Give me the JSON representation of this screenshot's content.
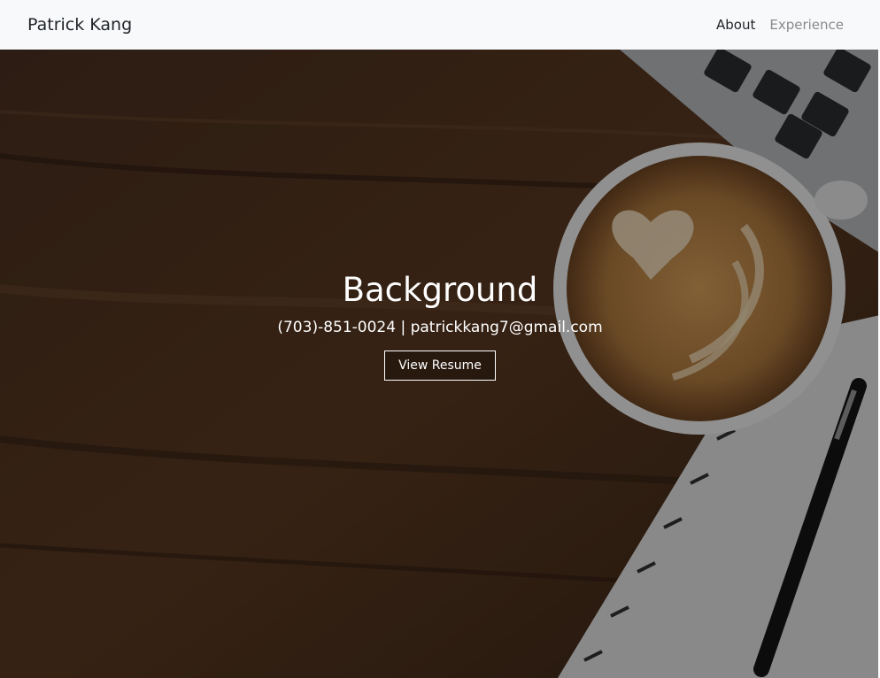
{
  "navbar": {
    "brand": "Patrick Kang",
    "links": [
      {
        "label": "About",
        "active": true
      },
      {
        "label": "Experience",
        "active": false
      }
    ]
  },
  "hero": {
    "title": "Background",
    "contact": "(703)-851-0024 | patrickkang7@gmail.com",
    "button_label": "View Resume"
  },
  "colors": {
    "navbar_bg": "#f8f9fa",
    "wood_dark": "#3a2618",
    "coffee_crema": "#b07a3f",
    "text_light": "#ffffff"
  }
}
